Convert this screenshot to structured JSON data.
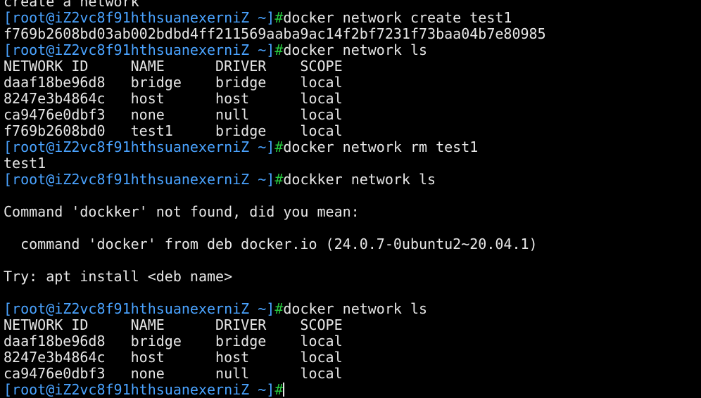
{
  "terminal": {
    "colors": {
      "background": "#000000",
      "text": "#e6e6e6",
      "prompt": "#4aa3ff",
      "hash": "#27c93f"
    },
    "prompt_text": "[root@iZ2vc8f91hthsuanexerniZ ~]",
    "hash": "#",
    "lines": [
      {
        "type": "out",
        "text": "create a network"
      },
      {
        "type": "cmd",
        "text": "docker network create test1"
      },
      {
        "type": "out",
        "text": "f769b2608bd03ab002bdbd4ff211569aaba9ac14f2bf7231f73baa04b7e80985"
      },
      {
        "type": "cmd",
        "text": "docker network ls"
      },
      {
        "type": "out",
        "text": "NETWORK ID     NAME      DRIVER    SCOPE"
      },
      {
        "type": "out",
        "text": "daaf18be96d8   bridge    bridge    local"
      },
      {
        "type": "out",
        "text": "8247e3b4864c   host      host      local"
      },
      {
        "type": "out",
        "text": "ca9476e0dbf3   none      null      local"
      },
      {
        "type": "out",
        "text": "f769b2608bd0   test1     bridge    local"
      },
      {
        "type": "cmd",
        "text": "docker network rm test1"
      },
      {
        "type": "out",
        "text": "test1"
      },
      {
        "type": "cmd",
        "text": "dockker network ls"
      },
      {
        "type": "out",
        "text": ""
      },
      {
        "type": "out",
        "text": "Command 'dockker' not found, did you mean:"
      },
      {
        "type": "out",
        "text": ""
      },
      {
        "type": "out",
        "text": "  command 'docker' from deb docker.io (24.0.7-0ubuntu2~20.04.1)"
      },
      {
        "type": "out",
        "text": ""
      },
      {
        "type": "out",
        "text": "Try: apt install <deb name>"
      },
      {
        "type": "out",
        "text": ""
      },
      {
        "type": "cmd",
        "text": "docker network ls"
      },
      {
        "type": "out",
        "text": "NETWORK ID     NAME      DRIVER    SCOPE"
      },
      {
        "type": "out",
        "text": "daaf18be96d8   bridge    bridge    local"
      },
      {
        "type": "out",
        "text": "8247e3b4864c   host      host      local"
      },
      {
        "type": "out",
        "text": "ca9476e0dbf3   none      null      local"
      },
      {
        "type": "cmd",
        "text": "",
        "cursor": true
      }
    ]
  }
}
